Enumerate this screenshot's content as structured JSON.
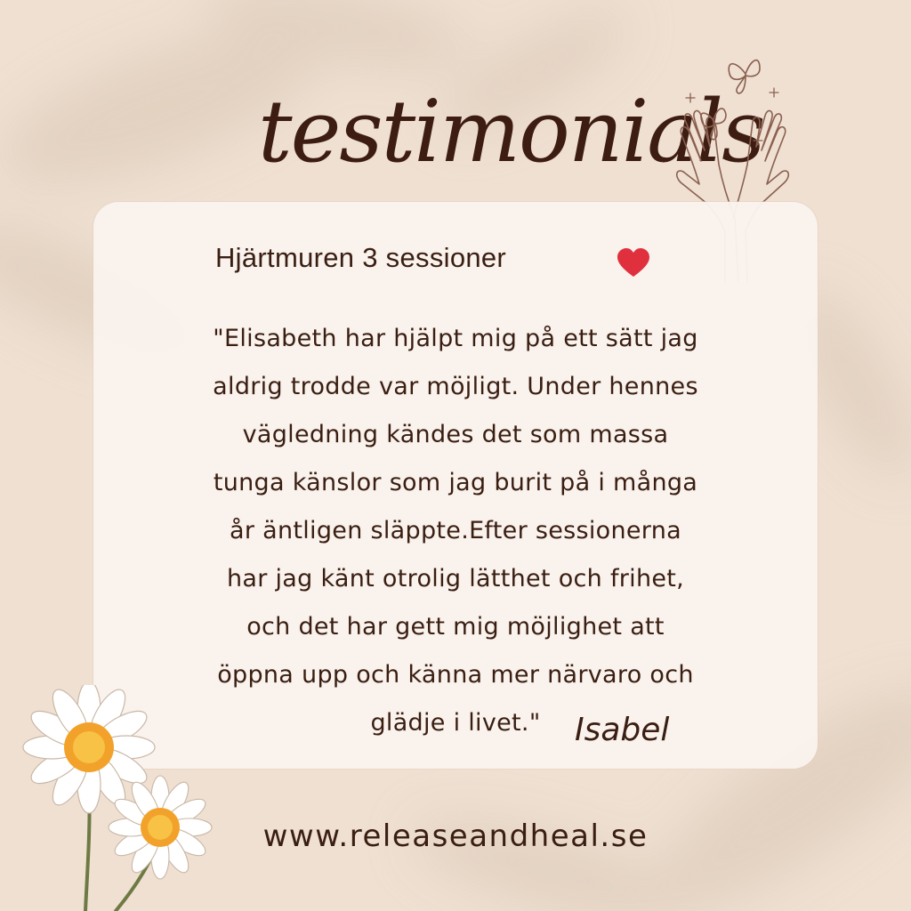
{
  "title": "testimonials",
  "card": {
    "heading": "Hjärtmuren 3 sessioner",
    "heart_icon": "heart-icon",
    "heart_color": "#e0303e",
    "quote_lines": [
      "\"Elisabeth har hjälpt mig på ett sätt jag",
      "aldrig trodde var möjligt. Under hennes",
      "vägledning kändes det som massa",
      "tunga känslor som jag burit på i många",
      "år äntligen släppte.Efter sessionerna",
      "har jag känt otrolig lätthet och frihet,",
      "och det har gett mig möjlighet att",
      "öppna upp och känna mer närvaro och",
      "glädje i livet.\""
    ],
    "author": "Isabel"
  },
  "website": "www.releaseandheal.se",
  "colors": {
    "background": "#efe0d2",
    "card": "#f9f3ee",
    "text": "#3a1e12",
    "line_art": "#8a5f4f"
  },
  "decorations": [
    "open-hands-icon",
    "butterfly-icon",
    "sparkle-icon",
    "daisy-icon"
  ]
}
